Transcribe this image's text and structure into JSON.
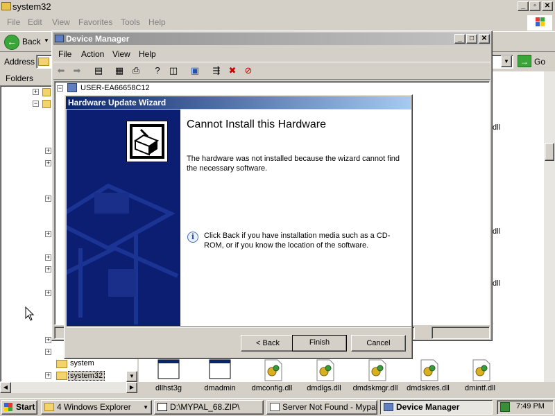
{
  "explorer": {
    "title": "system32",
    "menu": [
      "File",
      "Edit",
      "View",
      "Favorites",
      "Tools",
      "Help"
    ],
    "back_label": "Back",
    "address_label": "Address",
    "go_label": "Go",
    "folders_label": "Folders",
    "tree": [
      {
        "label": "system",
        "expander": "+"
      },
      {
        "label": "system32",
        "expander": "+",
        "selected": true
      }
    ],
    "files": [
      {
        "name": "dllhst3g",
        "icon": "window-exe-icon"
      },
      {
        "name": "dmadmin",
        "icon": "window-exe-icon"
      },
      {
        "name": "dmconfig.dll",
        "icon": "dll-gear-icon"
      },
      {
        "name": "dmdlgs.dll",
        "icon": "dll-gear-icon"
      },
      {
        "name": "dmdskmgr.dll",
        "icon": "dll-gear-icon"
      },
      {
        "name": "dmdskres.dll",
        "icon": "dll-gear-icon"
      },
      {
        "name": "dmintf.dll",
        "icon": "dll-gear-icon"
      }
    ],
    "partial_dll": "dll"
  },
  "device_manager": {
    "title": "Device Manager",
    "menu": [
      "File",
      "Action",
      "View",
      "Help"
    ],
    "root_node": "USER-EA66658C12"
  },
  "wizard": {
    "title": "Hardware Update Wizard",
    "heading": "Cannot Install this Hardware",
    "message": "The hardware was not installed because the wizard cannot find the necessary software.",
    "info": "Click Back if you have installation media such as a CD-ROM, or if you know the location of the software.",
    "buttons": {
      "back": "< Back",
      "finish": "Finish",
      "cancel": "Cancel"
    }
  },
  "taskbar": {
    "start": "Start",
    "tasks": [
      {
        "label": "4 Windows Explorer",
        "icon": "folder-icon"
      },
      {
        "label": "D:\\MYPAL_68.ZIP\\",
        "icon": "zip-icon"
      },
      {
        "label": "Server Not Found - Mypal",
        "icon": "browser-icon"
      },
      {
        "label": "Device Manager",
        "icon": "device-manager-icon",
        "active": true
      }
    ],
    "clock": "7:49 PM"
  },
  "colors": {
    "wizard_title_start": "#0a246a",
    "wizard_title_end": "#a6caf0",
    "wizard_banner": "#0b1e72",
    "desktop": "#7f97c5"
  }
}
